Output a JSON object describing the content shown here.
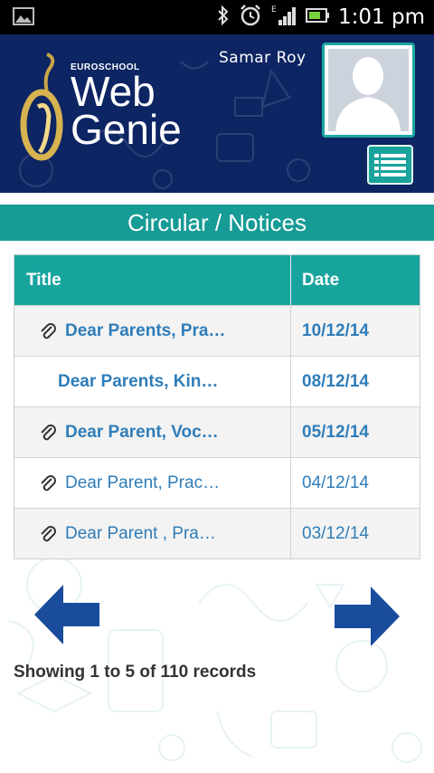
{
  "status_bar": {
    "time": "1:01 pm"
  },
  "header": {
    "logo_small": "EUROSCHOOL",
    "logo_line1": "Web",
    "logo_line2": "Genie",
    "username": "Samar Roy"
  },
  "page_title": "Circular / Notices",
  "table": {
    "columns": [
      "Title",
      "Date"
    ],
    "rows": [
      {
        "title": "Dear Parents, Pra…",
        "date": "10/12/14",
        "attachment": true,
        "unread": true
      },
      {
        "title": "Dear Parents, Kin…",
        "date": "08/12/14",
        "attachment": false,
        "unread": true
      },
      {
        "title": "Dear Parent, Voc…",
        "date": "05/12/14",
        "attachment": true,
        "unread": true
      },
      {
        "title": "Dear Parent, Prac…",
        "date": "04/12/14",
        "attachment": true,
        "unread": false
      },
      {
        "title": "Dear Parent , Pra…",
        "date": "03/12/14",
        "attachment": true,
        "unread": false
      }
    ]
  },
  "records_text": "Showing 1 to 5 of 110 records",
  "colors": {
    "header_bg": "#0e2563",
    "accent": "#17a49d",
    "link": "#2f7db9",
    "arrow": "#1a4c9c"
  }
}
